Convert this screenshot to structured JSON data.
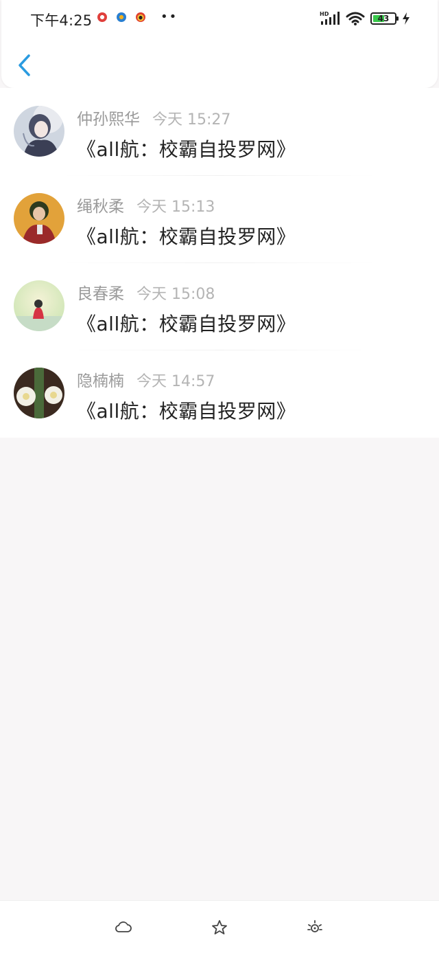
{
  "status_bar": {
    "time": "下午4:25",
    "network": "HD",
    "battery": "43"
  },
  "icons": {
    "back": "chevron-left-icon",
    "tab1": "cloud-icon",
    "tab2": "star-icon",
    "tab3": "sun-icon"
  },
  "colors": {
    "accent": "#2a9be0",
    "battery_fill": "#38c84a"
  },
  "list": [
    {
      "name": "仲孙熙华",
      "time": "今天 15:27",
      "title": "《all航：校霸自投罗网》"
    },
    {
      "name": "绳秋柔",
      "time": "今天 15:13",
      "title": "《all航：校霸自投罗网》"
    },
    {
      "name": "良春柔",
      "time": "今天 15:08",
      "title": "《all航：校霸自投罗网》"
    },
    {
      "name": "隐楠楠",
      "time": "今天 14:57",
      "title": "《all航：校霸自投罗网》"
    }
  ]
}
